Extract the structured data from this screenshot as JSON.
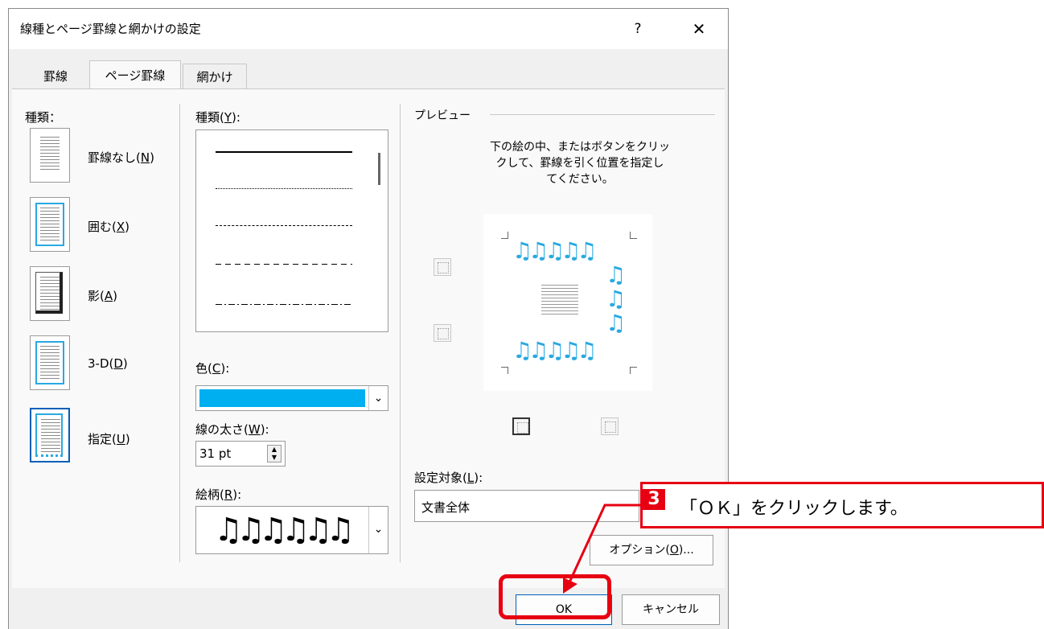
{
  "dialog": {
    "title": "線種とページ罫線と網かけの設定",
    "help": "?",
    "close": "✕",
    "tabs": [
      "罫線",
      "ページ罫線",
      "網かけ"
    ],
    "active_tab": "ページ罫線"
  },
  "setting": {
    "heading": "種類：",
    "items": [
      {
        "label": "罫線なし(",
        "key": "N",
        "tail": ")"
      },
      {
        "label": "囲む(",
        "key": "X",
        "tail": ")"
      },
      {
        "label": "影(",
        "key": "A",
        "tail": ")"
      },
      {
        "label": "3-D(",
        "key": "D",
        "tail": ")"
      },
      {
        "label": "指定(",
        "key": "U",
        "tail": ")"
      }
    ],
    "selected": "指定(U)"
  },
  "style": {
    "label": "種類(",
    "key": "Y",
    "tail": "):",
    "line_styles": [
      "solid",
      "dotted",
      "dashed",
      "wide-dashed",
      "dash-dot"
    ]
  },
  "color": {
    "label": "色(",
    "key": "C",
    "tail": "):",
    "value_hex": "#00aff0"
  },
  "width": {
    "label": "線の太さ(",
    "key": "W",
    "tail": "):",
    "value": "31 pt"
  },
  "art": {
    "label": "絵柄(",
    "key": "R",
    "tail": "):",
    "sample": "♫♫♫♫♫♫"
  },
  "preview": {
    "heading": "プレビュー",
    "help_lines": [
      "下の絵の中、またはボタンをクリッ",
      "クして、罫線を引く位置を指定し",
      "てください。"
    ],
    "note_glyph": "♫",
    "note_color": "#29a9e1"
  },
  "apply_to": {
    "label": "設定対象(",
    "key": "L",
    "tail": "):",
    "value": "文書全体"
  },
  "buttons": {
    "options": "オプション(",
    "options_key": "O",
    "options_tail": ")...",
    "ok": "OK",
    "cancel": "キャンセル"
  },
  "annotation": {
    "step": "3",
    "text": "「ＯＫ」をクリックします。",
    "color": "#e60012"
  }
}
